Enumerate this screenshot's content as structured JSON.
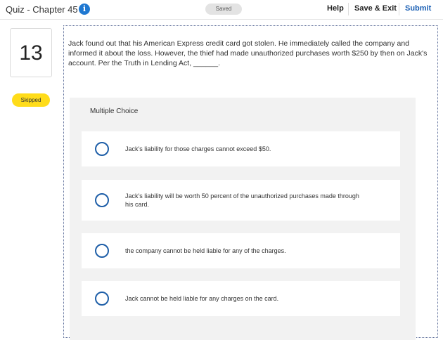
{
  "header": {
    "quiz_title": "Quiz - Chapter 45",
    "info_glyph": "i",
    "saved_label": "Saved",
    "help_label": "Help",
    "save_exit_label": "Save & Exit",
    "submit_label": "Submit"
  },
  "question": {
    "number": "13",
    "status": "Skipped",
    "text": "Jack found out that his American Express credit card got stolen. He immediately called the company and informed it about the loss. However, the thief had made unauthorized purchases worth $250 by then on Jack's account. Per the Truth in Lending Act, ______."
  },
  "multiple_choice": {
    "label": "Multiple Choice",
    "options": [
      {
        "text": "Jack's liability for those charges cannot exceed $50."
      },
      {
        "text": "Jack's liability will be worth 50 percent of the unauthorized purchases made through his card."
      },
      {
        "text": "the company cannot be held liable for any of the charges."
      },
      {
        "text": "Jack cannot be held liable for any charges on the card."
      }
    ]
  },
  "colors": {
    "accent": "#1f5fa8",
    "submit": "#1a5fb4",
    "badge": "#ffdc1a",
    "card_bg": "#f2f2f2"
  }
}
